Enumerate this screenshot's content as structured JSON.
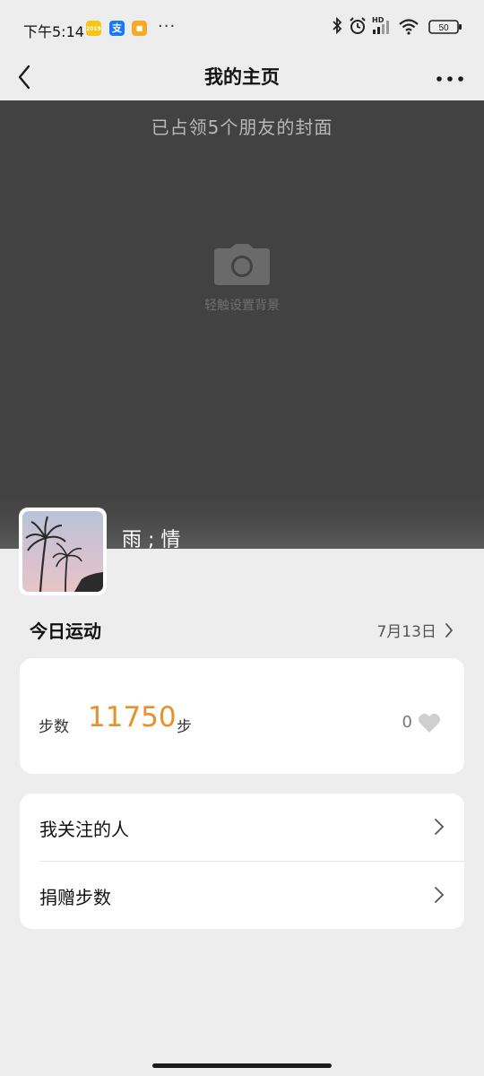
{
  "status_bar": {
    "time": "下午5:14",
    "app_icons": [
      {
        "name": "app-badge-1",
        "text": "2019",
        "color": "#f5c518"
      },
      {
        "name": "alipay-icon",
        "text": "支",
        "color": "#1677ff"
      },
      {
        "name": "app-badge-3",
        "text": "■",
        "color": "#f7a928"
      }
    ],
    "more": "···",
    "network_label": "HD",
    "battery": "50"
  },
  "nav": {
    "title": "我的主页"
  },
  "cover": {
    "occupied_text": "已占领5个朋友的封面",
    "set_background_hint": "轻触设置背景"
  },
  "profile": {
    "username": "雨 ; 情"
  },
  "today": {
    "title": "今日运动",
    "date": "7月13日",
    "steps_label": "步数",
    "steps_value": "11750",
    "steps_unit": "步",
    "likes": "0"
  },
  "menu": {
    "items": [
      {
        "label": "我关注的人"
      },
      {
        "label": "捐赠步数"
      }
    ]
  },
  "colors": {
    "accent_orange": "#e8902b",
    "cover_bg": "#424242",
    "page_bg": "#ededed"
  }
}
